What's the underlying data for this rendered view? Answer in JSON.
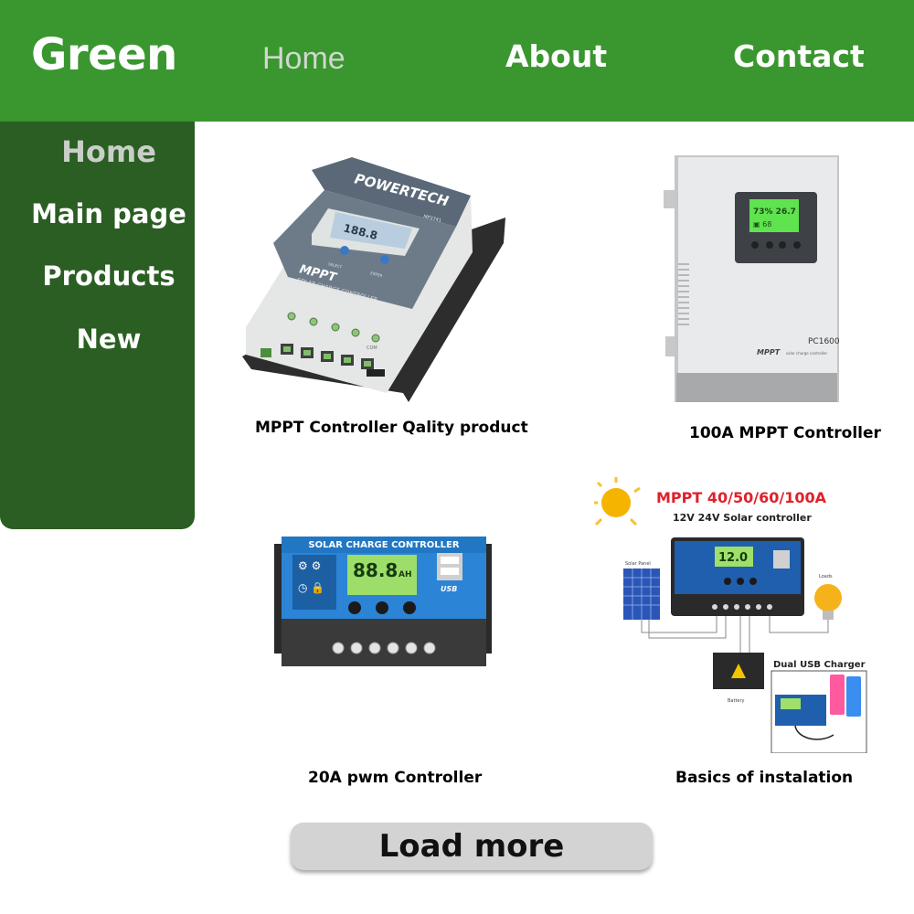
{
  "header": {
    "brand": "Green",
    "nav": [
      {
        "label": "Home",
        "active": true
      },
      {
        "label": "About",
        "active": false
      },
      {
        "label": "Contact",
        "active": false
      }
    ]
  },
  "sidebar": {
    "items": [
      {
        "label": "Home",
        "active": true
      },
      {
        "label": "Main page",
        "active": false
      },
      {
        "label": "Products",
        "active": false
      },
      {
        "label": "New",
        "active": false
      }
    ]
  },
  "products": [
    {
      "caption": "MPPT Controller Qality product",
      "image_text": {
        "brand": "POWERTECH",
        "model": "MP3741",
        "title": "MPPT",
        "subtitle": "SOLAR CHARGE CONTROLLER",
        "btn_left": "SELECT",
        "btn_right": "ENTER",
        "port": "COM"
      }
    },
    {
      "caption": "100A MPPT Controller",
      "image_text": {
        "model": "PC1600",
        "title": "MPPT",
        "subtitle": "solar charge controller"
      }
    },
    {
      "caption": "20A pwm Controller",
      "image_text": {
        "title": "SOLAR CHARGE CONTROLLER",
        "lcd_value": "88.8",
        "lcd_unit": "AH",
        "usb": "USB"
      }
    },
    {
      "caption": "Basics of instalation",
      "image_text": {
        "headline": "MPPT 40/50/60/100A",
        "subline": "12V 24V Solar controller",
        "lcd_value": "12.0",
        "panel_label": "Solar Panel",
        "load_label": "Loads",
        "battery_label": "Battery",
        "usb_label": "Dual USB Charger"
      }
    }
  ],
  "actions": {
    "load_more": "Load more"
  },
  "colors": {
    "header_green": "#3a962f",
    "sidebar_green": "#2a5e22",
    "button_gray": "#d3d3d3"
  }
}
